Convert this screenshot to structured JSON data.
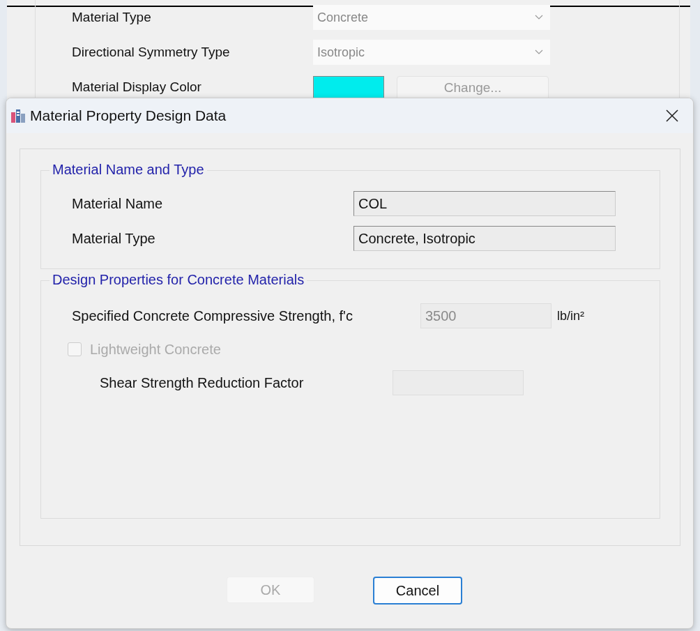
{
  "background_window": {
    "rows": [
      {
        "kind": "dropdown",
        "label": "Material Type",
        "value": "Concrete",
        "disabled": true
      },
      {
        "kind": "dropdown",
        "label": "Directional Symmetry Type",
        "value": "Isotropic",
        "disabled": true
      },
      {
        "kind": "color",
        "label": "Material Display Color",
        "color": "#00eced",
        "button": "Change...",
        "disabled": true
      }
    ]
  },
  "dialog": {
    "title": "Material Property Design Data",
    "groups": [
      {
        "title": "Material Name and Type",
        "fields": [
          {
            "kind": "text",
            "label": "Material Name",
            "value": "COL",
            "disabled": false
          },
          {
            "kind": "text",
            "label": "Material Type",
            "value": "Concrete, Isotropic",
            "disabled": false
          }
        ]
      },
      {
        "title": "Design Properties for Concrete Materials",
        "fields": [
          {
            "kind": "number",
            "label": "Specified Concrete Compressive Strength, f'c",
            "value": "3500",
            "unit": "lb/in²",
            "disabled": true
          },
          {
            "kind": "checkbox",
            "label": "Lightweight Concrete",
            "checked": false,
            "disabled": true,
            "children": [
              {
                "kind": "number",
                "label": "Shear Strength Reduction Factor",
                "disabled": true
              }
            ]
          }
        ]
      }
    ],
    "buttons": [
      {
        "label": "OK",
        "disabled": true,
        "focused": false
      },
      {
        "label": "Cancel",
        "disabled": false,
        "focused": true
      }
    ]
  }
}
